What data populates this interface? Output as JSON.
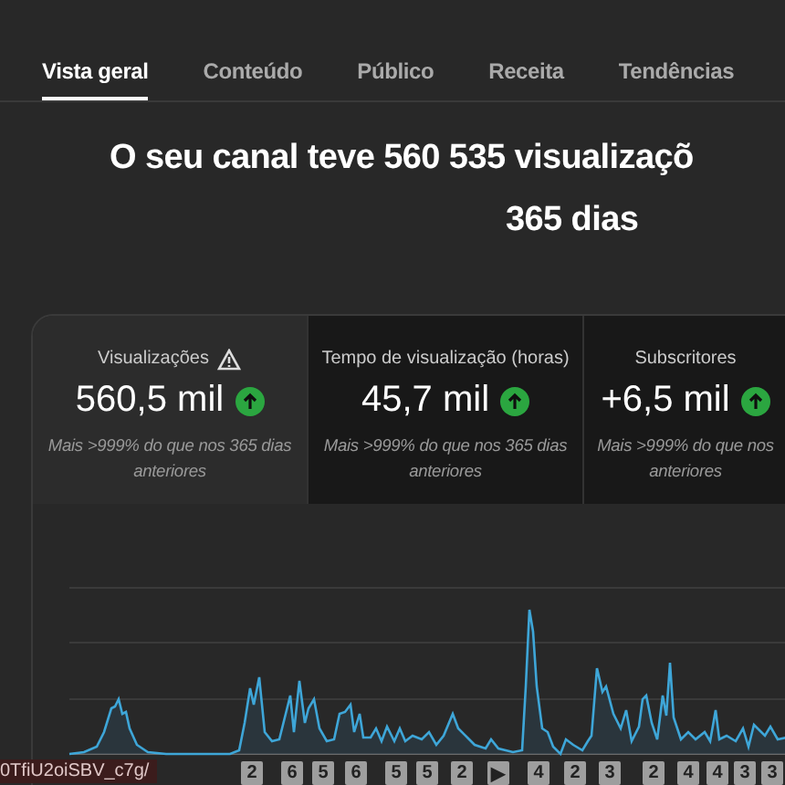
{
  "tabs": [
    {
      "label": "Vista geral",
      "selected": true
    },
    {
      "label": "Conteúdo",
      "selected": false
    },
    {
      "label": "Público",
      "selected": false
    },
    {
      "label": "Receita",
      "selected": false
    },
    {
      "label": "Tendências",
      "selected": false
    }
  ],
  "headline": [
    "O seu canal teve 560 535 visualizaçõ",
    "365 dias"
  ],
  "metrics": [
    {
      "title": "Visualizações",
      "warning": true,
      "value": "560,5 mil",
      "rising": true,
      "note": "Mais >999% do que nos 365 dias anteriores",
      "selected": true
    },
    {
      "title": "Tempo de visualização (horas)",
      "warning": false,
      "value": "45,7 mil",
      "rising": true,
      "note": "Mais >999% do que nos 365 dias anteriores",
      "selected": false
    },
    {
      "title": "Subscritores",
      "warning": false,
      "value": "+6,5 mil",
      "rising": true,
      "note": "Mais >999% do que nos anteriores",
      "selected": false
    }
  ],
  "chart": {
    "kind": "picture"
  },
  "video_markers": [
    {
      "label": "2"
    },
    {
      "label": "6"
    },
    {
      "label": "5"
    },
    {
      "label": "6"
    },
    {
      "label": "5"
    },
    {
      "label": "5"
    },
    {
      "label": "2"
    },
    {
      "label": "▶"
    },
    {
      "label": "4"
    },
    {
      "label": "2"
    },
    {
      "label": "3"
    },
    {
      "label": "2"
    },
    {
      "label": "4"
    },
    {
      "label": "4"
    },
    {
      "label": "3"
    },
    {
      "label": "3"
    }
  ],
  "status_url": "0TfiU2oiSBV_c7g/"
}
